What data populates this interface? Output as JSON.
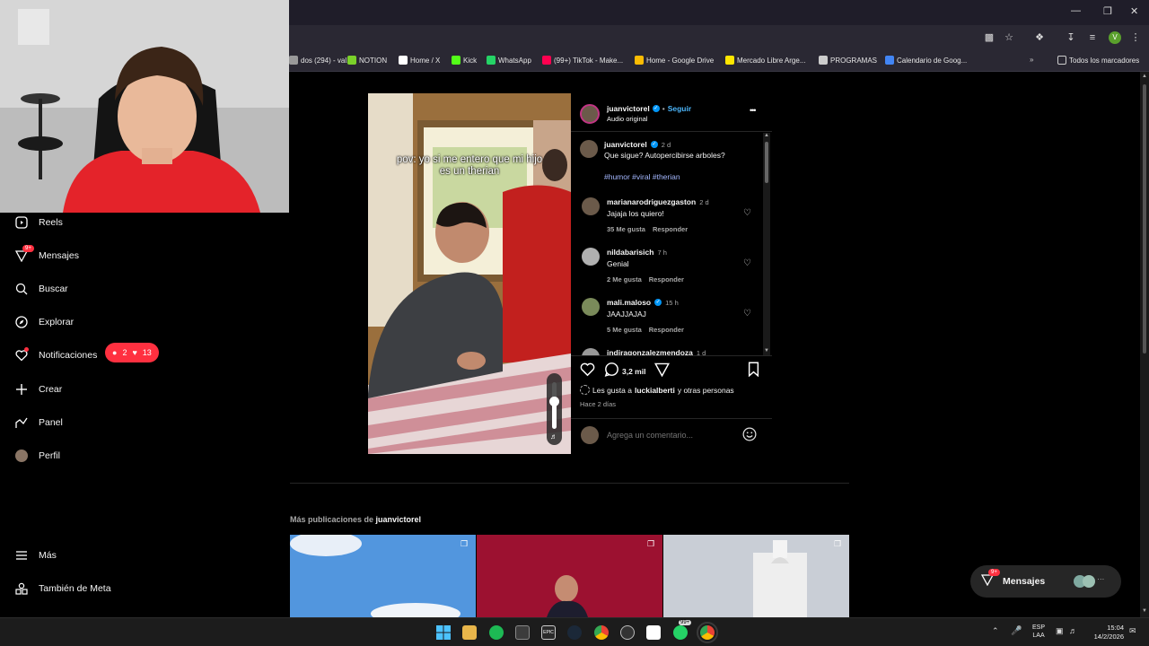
{
  "browser": {
    "bookmarks": [
      {
        "label": "dos (294) - val...",
        "color": "#999999"
      },
      {
        "label": "NOTION",
        "color": "#7bd12a"
      },
      {
        "label": "Home / X",
        "color": "#ffffff"
      },
      {
        "label": "Kick",
        "color": "#53fc18"
      },
      {
        "label": "WhatsApp",
        "color": "#25d366"
      },
      {
        "label": "(99+) TikTok - Make...",
        "color": "#ff0050"
      },
      {
        "label": "Home - Google Drive",
        "color": "#fbbc04"
      },
      {
        "label": "Mercado Libre Arge...",
        "color": "#ffe600"
      },
      {
        "label": "PROGRAMAS",
        "color": "#cccccc"
      },
      {
        "label": "Calendario de Goog...",
        "color": "#4285f4"
      }
    ],
    "all_bookmarks": "Todos los marcadores",
    "profile_initial": "V"
  },
  "sidebar": {
    "items": [
      {
        "label": "Reels",
        "icon": "reels-icon"
      },
      {
        "label": "Mensajes",
        "icon": "messages-icon",
        "badge": "9+"
      },
      {
        "label": "Buscar",
        "icon": "search-icon"
      },
      {
        "label": "Explorar",
        "icon": "explore-icon"
      },
      {
        "label": "Notificaciones",
        "icon": "heart-icon"
      },
      {
        "label": "Crear",
        "icon": "plus-icon"
      },
      {
        "label": "Panel",
        "icon": "panel-icon"
      },
      {
        "label": "Perfil",
        "icon": "profile-icon"
      }
    ],
    "notif_pill": {
      "comments": "2",
      "likes": "13"
    },
    "more": "Más",
    "meta": "También de Meta"
  },
  "post": {
    "caption_overlay": "pov: yo si me entero que mi hijo es un therian",
    "author": "juanvictorel",
    "follow": "Seguir",
    "audio": "Audio original",
    "more_options": "•••",
    "caption": {
      "user": "juanvictorel",
      "time": "2 d",
      "text": "Que sigue? Autopercibirse arboles?",
      "tags": "#humor #viral #therian"
    },
    "comments": [
      {
        "user": "marianarodriguezgaston",
        "time": "2 d",
        "text": "Jajaja los quiero!",
        "likes": "35 Me gusta",
        "reply": "Responder",
        "verified": false
      },
      {
        "user": "nildabarisich",
        "time": "7 h",
        "text": "Genial",
        "likes": "2 Me gusta",
        "reply": "Responder",
        "verified": false
      },
      {
        "user": "mali.maloso",
        "time": "15 h",
        "text": "JAAJJAJAJ",
        "likes": "5 Me gusta",
        "reply": "Responder",
        "verified": true
      },
      {
        "user": "indiragonzalezmendoza",
        "time": "1 d",
        "text": "",
        "likes": "",
        "reply": "",
        "verified": false
      }
    ],
    "comment_count": "3,2 mil",
    "liked_by_prefix": "Les gusta a",
    "liked_by_user": "luckialberti",
    "liked_by_suffix": "y otras personas",
    "posted_ago": "Hace 2 días",
    "add_comment_placeholder": "Agrega un comentario..."
  },
  "more_posts": {
    "label": "Más publicaciones de",
    "user": "juanvictorel"
  },
  "messages_pill": {
    "label": "Mensajes",
    "badge": "9+"
  },
  "taskbar": {
    "lang_top": "ESP",
    "lang_bottom": "LAA",
    "time": "15:04",
    "date": "14/2/2026",
    "whatsapp_badge": "99+"
  }
}
